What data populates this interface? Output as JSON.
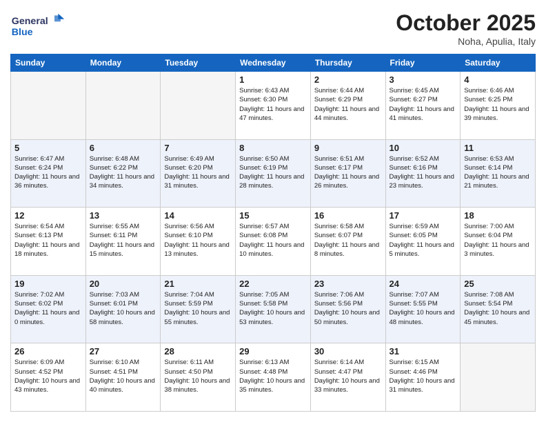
{
  "header": {
    "logo_general": "General",
    "logo_blue": "Blue",
    "month": "October 2025",
    "location": "Noha, Apulia, Italy"
  },
  "weekdays": [
    "Sunday",
    "Monday",
    "Tuesday",
    "Wednesday",
    "Thursday",
    "Friday",
    "Saturday"
  ],
  "weeks": [
    [
      {
        "day": "",
        "sunrise": "",
        "sunset": "",
        "daylight": ""
      },
      {
        "day": "",
        "sunrise": "",
        "sunset": "",
        "daylight": ""
      },
      {
        "day": "",
        "sunrise": "",
        "sunset": "",
        "daylight": ""
      },
      {
        "day": "1",
        "sunrise": "Sunrise: 6:43 AM",
        "sunset": "Sunset: 6:30 PM",
        "daylight": "Daylight: 11 hours and 47 minutes."
      },
      {
        "day": "2",
        "sunrise": "Sunrise: 6:44 AM",
        "sunset": "Sunset: 6:29 PM",
        "daylight": "Daylight: 11 hours and 44 minutes."
      },
      {
        "day": "3",
        "sunrise": "Sunrise: 6:45 AM",
        "sunset": "Sunset: 6:27 PM",
        "daylight": "Daylight: 11 hours and 41 minutes."
      },
      {
        "day": "4",
        "sunrise": "Sunrise: 6:46 AM",
        "sunset": "Sunset: 6:25 PM",
        "daylight": "Daylight: 11 hours and 39 minutes."
      }
    ],
    [
      {
        "day": "5",
        "sunrise": "Sunrise: 6:47 AM",
        "sunset": "Sunset: 6:24 PM",
        "daylight": "Daylight: 11 hours and 36 minutes."
      },
      {
        "day": "6",
        "sunrise": "Sunrise: 6:48 AM",
        "sunset": "Sunset: 6:22 PM",
        "daylight": "Daylight: 11 hours and 34 minutes."
      },
      {
        "day": "7",
        "sunrise": "Sunrise: 6:49 AM",
        "sunset": "Sunset: 6:20 PM",
        "daylight": "Daylight: 11 hours and 31 minutes."
      },
      {
        "day": "8",
        "sunrise": "Sunrise: 6:50 AM",
        "sunset": "Sunset: 6:19 PM",
        "daylight": "Daylight: 11 hours and 28 minutes."
      },
      {
        "day": "9",
        "sunrise": "Sunrise: 6:51 AM",
        "sunset": "Sunset: 6:17 PM",
        "daylight": "Daylight: 11 hours and 26 minutes."
      },
      {
        "day": "10",
        "sunrise": "Sunrise: 6:52 AM",
        "sunset": "Sunset: 6:16 PM",
        "daylight": "Daylight: 11 hours and 23 minutes."
      },
      {
        "day": "11",
        "sunrise": "Sunrise: 6:53 AM",
        "sunset": "Sunset: 6:14 PM",
        "daylight": "Daylight: 11 hours and 21 minutes."
      }
    ],
    [
      {
        "day": "12",
        "sunrise": "Sunrise: 6:54 AM",
        "sunset": "Sunset: 6:13 PM",
        "daylight": "Daylight: 11 hours and 18 minutes."
      },
      {
        "day": "13",
        "sunrise": "Sunrise: 6:55 AM",
        "sunset": "Sunset: 6:11 PM",
        "daylight": "Daylight: 11 hours and 15 minutes."
      },
      {
        "day": "14",
        "sunrise": "Sunrise: 6:56 AM",
        "sunset": "Sunset: 6:10 PM",
        "daylight": "Daylight: 11 hours and 13 minutes."
      },
      {
        "day": "15",
        "sunrise": "Sunrise: 6:57 AM",
        "sunset": "Sunset: 6:08 PM",
        "daylight": "Daylight: 11 hours and 10 minutes."
      },
      {
        "day": "16",
        "sunrise": "Sunrise: 6:58 AM",
        "sunset": "Sunset: 6:07 PM",
        "daylight": "Daylight: 11 hours and 8 minutes."
      },
      {
        "day": "17",
        "sunrise": "Sunrise: 6:59 AM",
        "sunset": "Sunset: 6:05 PM",
        "daylight": "Daylight: 11 hours and 5 minutes."
      },
      {
        "day": "18",
        "sunrise": "Sunrise: 7:00 AM",
        "sunset": "Sunset: 6:04 PM",
        "daylight": "Daylight: 11 hours and 3 minutes."
      }
    ],
    [
      {
        "day": "19",
        "sunrise": "Sunrise: 7:02 AM",
        "sunset": "Sunset: 6:02 PM",
        "daylight": "Daylight: 11 hours and 0 minutes."
      },
      {
        "day": "20",
        "sunrise": "Sunrise: 7:03 AM",
        "sunset": "Sunset: 6:01 PM",
        "daylight": "Daylight: 10 hours and 58 minutes."
      },
      {
        "day": "21",
        "sunrise": "Sunrise: 7:04 AM",
        "sunset": "Sunset: 5:59 PM",
        "daylight": "Daylight: 10 hours and 55 minutes."
      },
      {
        "day": "22",
        "sunrise": "Sunrise: 7:05 AM",
        "sunset": "Sunset: 5:58 PM",
        "daylight": "Daylight: 10 hours and 53 minutes."
      },
      {
        "day": "23",
        "sunrise": "Sunrise: 7:06 AM",
        "sunset": "Sunset: 5:56 PM",
        "daylight": "Daylight: 10 hours and 50 minutes."
      },
      {
        "day": "24",
        "sunrise": "Sunrise: 7:07 AM",
        "sunset": "Sunset: 5:55 PM",
        "daylight": "Daylight: 10 hours and 48 minutes."
      },
      {
        "day": "25",
        "sunrise": "Sunrise: 7:08 AM",
        "sunset": "Sunset: 5:54 PM",
        "daylight": "Daylight: 10 hours and 45 minutes."
      }
    ],
    [
      {
        "day": "26",
        "sunrise": "Sunrise: 6:09 AM",
        "sunset": "Sunset: 4:52 PM",
        "daylight": "Daylight: 10 hours and 43 minutes."
      },
      {
        "day": "27",
        "sunrise": "Sunrise: 6:10 AM",
        "sunset": "Sunset: 4:51 PM",
        "daylight": "Daylight: 10 hours and 40 minutes."
      },
      {
        "day": "28",
        "sunrise": "Sunrise: 6:11 AM",
        "sunset": "Sunset: 4:50 PM",
        "daylight": "Daylight: 10 hours and 38 minutes."
      },
      {
        "day": "29",
        "sunrise": "Sunrise: 6:13 AM",
        "sunset": "Sunset: 4:48 PM",
        "daylight": "Daylight: 10 hours and 35 minutes."
      },
      {
        "day": "30",
        "sunrise": "Sunrise: 6:14 AM",
        "sunset": "Sunset: 4:47 PM",
        "daylight": "Daylight: 10 hours and 33 minutes."
      },
      {
        "day": "31",
        "sunrise": "Sunrise: 6:15 AM",
        "sunset": "Sunset: 4:46 PM",
        "daylight": "Daylight: 10 hours and 31 minutes."
      },
      {
        "day": "",
        "sunrise": "",
        "sunset": "",
        "daylight": ""
      }
    ]
  ]
}
